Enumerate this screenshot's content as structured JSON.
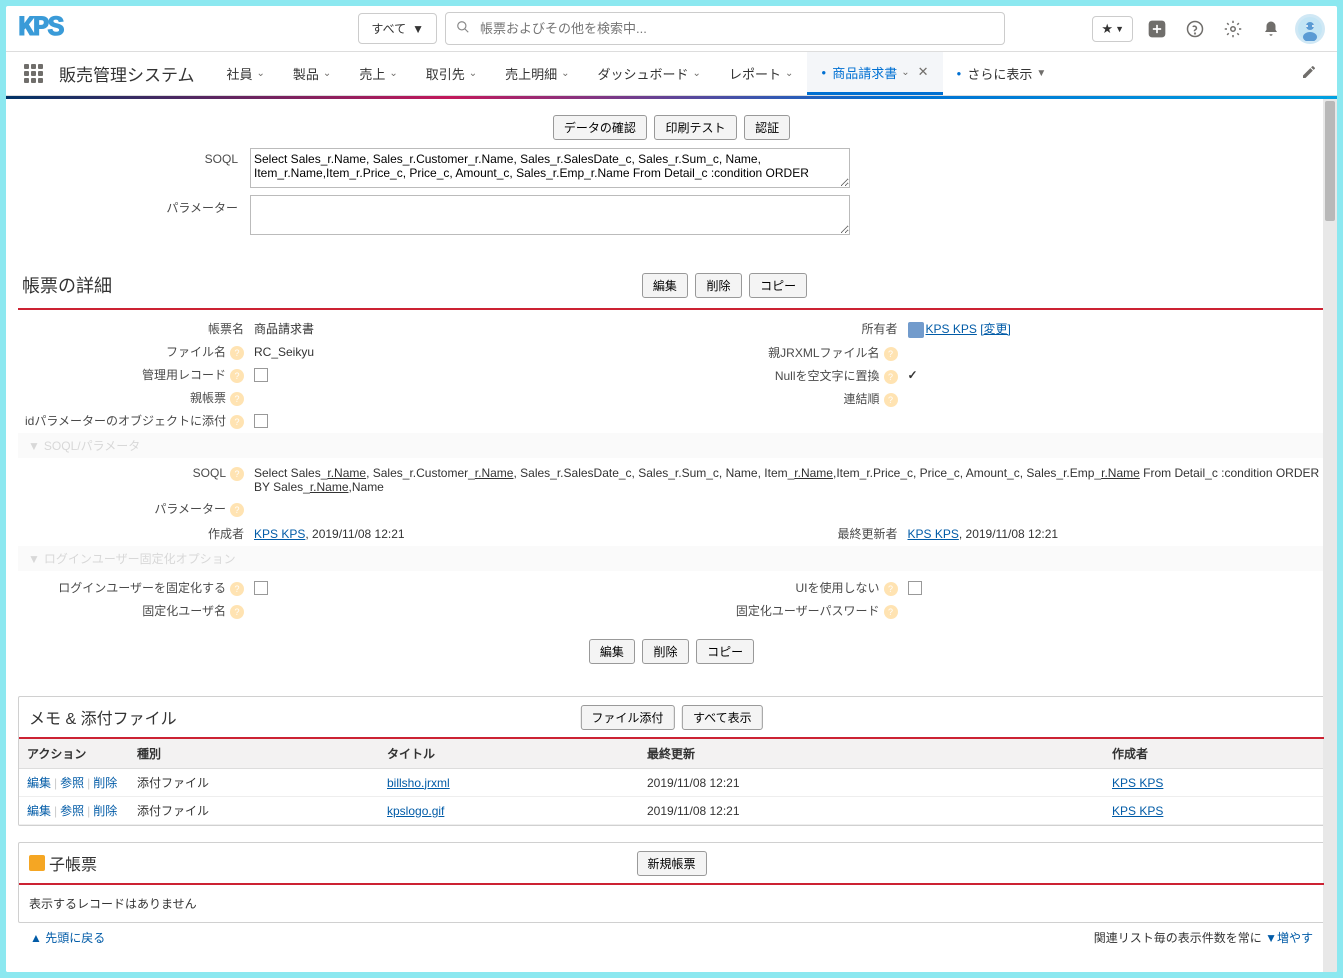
{
  "header": {
    "logo": "KPS",
    "search_scope": "すべて",
    "search_placeholder": "帳票およびその他を検索中..."
  },
  "nav": {
    "app_name": "販売管理システム",
    "tabs": [
      {
        "label": "社員"
      },
      {
        "label": "製品"
      },
      {
        "label": "売上"
      },
      {
        "label": "取引先"
      },
      {
        "label": "売上明細"
      },
      {
        "label": "ダッシュボード"
      },
      {
        "label": "レポート"
      }
    ],
    "active_tab": "商品請求書",
    "overflow": "さらに表示"
  },
  "top_buttons": {
    "confirm": "データの確認",
    "print_test": "印刷テスト",
    "auth": "認証"
  },
  "edit_fields": {
    "soql_label": "SOQL",
    "soql_value": "Select Sales_r.Name, Sales_r.Customer_r.Name, Sales_r.SalesDate_c, Sales_r.Sum_c, Name, Item_r.Name,Item_r.Price_c, Price_c, Amount_c, Sales_r.Emp_r.Name From Detail_c :condition ORDER",
    "param_label": "パラメーター",
    "param_value": ""
  },
  "detail_section": {
    "title": "帳票の詳細",
    "edit_btn": "編集",
    "delete_btn": "削除",
    "copy_btn": "コピー",
    "rows_left": {
      "report_name_label": "帳票名",
      "report_name_value": "商品請求書",
      "file_name_label": "ファイル名",
      "file_name_value": "RC_Seikyu",
      "manage_record_label": "管理用レコード",
      "parent_report_label": "親帳票",
      "attach_label": "idパラメーターのオブジェクトに添付"
    },
    "rows_right": {
      "owner_label": "所有者",
      "owner_value": "KPS KPS",
      "owner_change": "[変更]",
      "parent_jrxml_label": "親JRXMLファイル名",
      "null_replace_label": "Nullを空文字に置換",
      "null_replace_checked": "✓",
      "concat_label": "連結順"
    },
    "soql_section_header": "SOQL/パラメータ",
    "soql_detail_label": "SOQL",
    "soql_detail_value": "Select Sales_r.Name, Sales_r.Customer_r.Name, Sales_r.SalesDate_c, Sales_r.Sum_c, Name, Item_r.Name,Item_r.Price_c, Price_c, Amount_c, Sales_r.Emp_r.Name From Detail_c :condition ORDER BY Sales_r.Name,Name",
    "param_detail_label": "パラメーター",
    "creator_label": "作成者",
    "creator_user": "KPS KPS",
    "creator_date": ", 2019/11/08 12:21",
    "modifier_label": "最終更新者",
    "modifier_user": "KPS KPS",
    "modifier_date": ", 2019/11/08 12:21",
    "login_section_header": "ログインユーザー固定化オプション",
    "login_fix_label": "ログインユーザーを固定化する",
    "ui_disable_label": "UIを使用しない",
    "fixed_user_label": "固定化ユーザ名",
    "fixed_pw_label": "固定化ユーザーパスワード"
  },
  "memo_section": {
    "title": "メモ & 添付ファイル",
    "attach_btn": "ファイル添付",
    "show_all_btn": "すべて表示",
    "columns": {
      "action": "アクション",
      "type": "種別",
      "title": "タイトル",
      "updated": "最終更新",
      "creator": "作成者"
    },
    "action_edit": "編集",
    "action_ref": "参照",
    "action_del": "削除",
    "rows": [
      {
        "type": "添付ファイル",
        "title": "billsho.jrxml",
        "updated": "2019/11/08 12:21",
        "creator": "KPS KPS"
      },
      {
        "type": "添付ファイル",
        "title": "kpslogo.gif",
        "updated": "2019/11/08 12:21",
        "creator": "KPS KPS"
      }
    ]
  },
  "child_section": {
    "title": "子帳票",
    "new_btn": "新規帳票",
    "no_records": "表示するレコードはありません"
  },
  "footer": {
    "back_top": "先頭に戻る",
    "related_list": "関連リスト毎の表示件数を常に ",
    "increase": "増やす"
  }
}
